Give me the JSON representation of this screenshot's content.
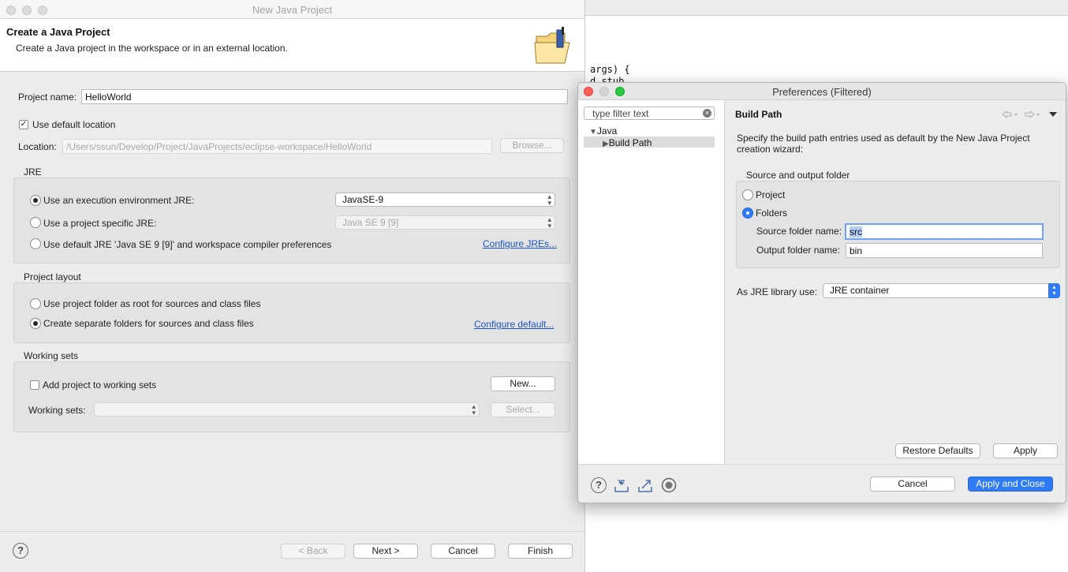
{
  "editor": {
    "code_line_1": "args) {",
    "code_line_2": "d stub"
  },
  "main_window": {
    "title": "New Java Project",
    "header_title": "Create a Java Project",
    "header_desc": "Create a Java project in the workspace or in an external location.",
    "project_name_label": "Project name:",
    "project_name_value": "HelloWorld",
    "use_default_location_label": "Use default location",
    "use_default_location_checked": true,
    "location_label": "Location:",
    "location_value": "/Users/ssun/Develop/Project/JavaProjects/eclipse-workspace/HelloWorld",
    "browse_label": "Browse...",
    "jre": {
      "group_label": "JRE",
      "opt_exec_env": "Use an execution environment JRE:",
      "exec_env_value": "JavaSE-9",
      "opt_project_specific": "Use a project specific JRE:",
      "project_specific_value": "Java SE 9 [9]",
      "opt_default": "Use default JRE 'Java SE 9 [9]' and workspace compiler preferences",
      "configure_link": "Configure JREs..."
    },
    "layout": {
      "group_label": "Project layout",
      "opt_root": "Use project folder as root for sources and class files",
      "opt_separate": "Create separate folders for sources and class files",
      "configure_link": "Configure default..."
    },
    "working_sets": {
      "group_label": "Working sets",
      "add_label": "Add project to working sets",
      "new_label": "New...",
      "sets_label": "Working sets:",
      "select_label": "Select..."
    },
    "buttons": {
      "back": "< Back",
      "next": "Next >",
      "cancel": "Cancel",
      "finish": "Finish"
    },
    "help_symbol": "?"
  },
  "preferences": {
    "title": "Preferences (Filtered)",
    "filter_placeholder": "type filter text",
    "tree": {
      "java": "Java",
      "build_path": "Build Path"
    },
    "page_title": "Build Path",
    "description": "Specify the build path entries used as default by the New Java Project creation wizard:",
    "source_output_group": "Source and output folder",
    "opt_project": "Project",
    "opt_folders": "Folders",
    "source_folder_label": "Source folder name:",
    "source_folder_value": "src",
    "output_folder_label": "Output folder name:",
    "output_folder_value": "bin",
    "jre_library_label": "As JRE library use:",
    "jre_library_value": "JRE container",
    "restore_defaults": "Restore Defaults",
    "apply": "Apply",
    "cancel": "Cancel",
    "apply_and_close": "Apply and Close",
    "help_symbol": "?"
  },
  "icons": {
    "header": "folder-icon",
    "help": "help-icon",
    "import": "import-icon",
    "export": "export-icon",
    "record": "record-icon",
    "back_arrow": "back-arrow-icon",
    "forward_arrow": "forward-arrow-icon",
    "view_menu": "view-menu-icon"
  },
  "colors": {
    "accent": "#2f7bf5",
    "link": "#1a55c4",
    "close_red": "#fe5f57",
    "zoom_green": "#28c840"
  }
}
